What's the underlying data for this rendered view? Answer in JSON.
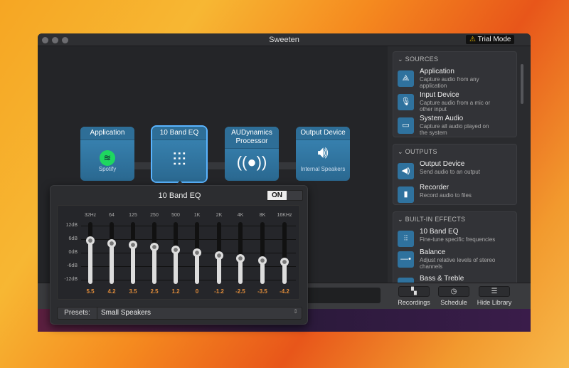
{
  "window": {
    "title": "Sweeten",
    "trial_badge": "Trial Mode"
  },
  "chain": [
    {
      "header": "Application",
      "sub": "Spotify",
      "icon": "spotify-icon"
    },
    {
      "header": "10 Band EQ",
      "sub": "",
      "icon": "sliders-icon"
    },
    {
      "header": "AUDynamics Processor",
      "sub": "",
      "icon": "broadcast-icon"
    },
    {
      "header": "Output Device",
      "sub": "Internal Speakers",
      "icon": "speaker-icon"
    }
  ],
  "eq": {
    "title": "10 Band EQ",
    "toggle": "ON",
    "bands": [
      "32Hz",
      "64",
      "125",
      "250",
      "500",
      "1K",
      "2K",
      "4K",
      "8K",
      "16KHz"
    ],
    "values": [
      5.5,
      4.2,
      3.5,
      2.5,
      1.2,
      0,
      -1.2,
      -2.5,
      -3.5,
      -4.2
    ],
    "value_labels": [
      "5.5",
      "4.2",
      "3.5",
      "2.5",
      "1.2",
      "0",
      "-1.2",
      "-2.5",
      "-3.5",
      "-4.2"
    ],
    "db_labels": [
      "12dB",
      "6dB",
      "0dB",
      "-6dB",
      "-12dB"
    ],
    "range": [
      -15,
      15
    ],
    "presets_label": "Presets:",
    "preset": "Small Speakers"
  },
  "sidebar": {
    "sources": {
      "title": "SOURCES",
      "items": [
        {
          "name": "Application",
          "desc": "Capture audio from any application"
        },
        {
          "name": "Input Device",
          "desc": "Capture audio from a mic or other input"
        },
        {
          "name": "System Audio",
          "desc": "Capture all audio played on the system"
        }
      ]
    },
    "outputs": {
      "title": "OUTPUTS",
      "items": [
        {
          "name": "Output Device",
          "desc": "Send audio to an output"
        },
        {
          "name": "Recorder",
          "desc": "Record audio to files"
        }
      ]
    },
    "effects": {
      "title": "BUILT-IN EFFECTS",
      "items": [
        {
          "name": "10 Band EQ",
          "desc": "Fine-tune specific frequencies"
        },
        {
          "name": "Balance",
          "desc": "Adjust relative levels of stereo channels"
        },
        {
          "name": "Bass & Treble",
          "desc": ""
        }
      ]
    }
  },
  "toolbar": {
    "recordings": "Recordings",
    "schedule": "Schedule",
    "hide_library": "Hide Library"
  },
  "colors": {
    "accent": "#2f729e",
    "value": "#e08c3a",
    "selection": "#5ab4ff"
  }
}
